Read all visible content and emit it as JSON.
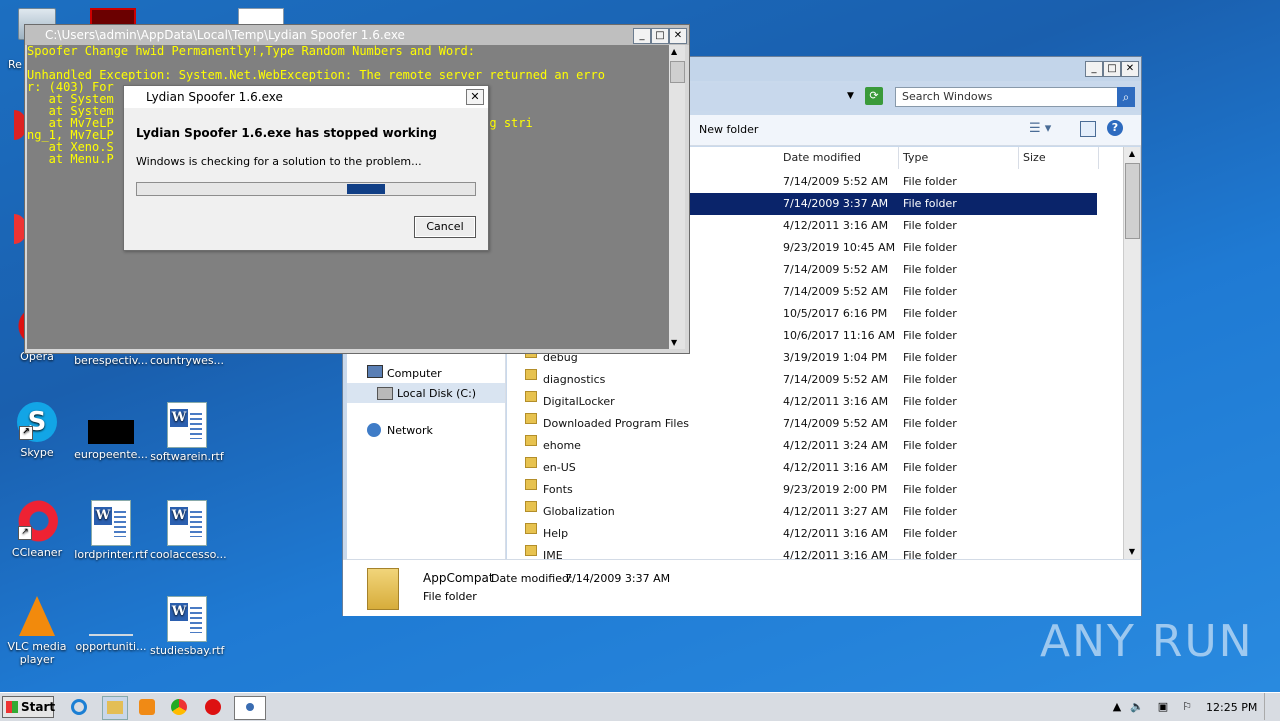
{
  "desktop": {
    "icons": [
      {
        "label": "Opera"
      },
      {
        "label": "berespectiv..."
      },
      {
        "label": "countrywes..."
      },
      {
        "label": "Skype"
      },
      {
        "label": "europeente..."
      },
      {
        "label": "softwarein.rtf"
      },
      {
        "label": "CCleaner"
      },
      {
        "label": "lordprinter.rtf"
      },
      {
        "label": "coolaccesso..."
      },
      {
        "label": "VLC media player"
      },
      {
        "label": "opportuniti..."
      },
      {
        "label": "studiesbay.rtf"
      }
    ],
    "partial_label_re": "Re",
    "watermark": "ANY RUN"
  },
  "console": {
    "title": "C:\\Users\\admin\\AppData\\Local\\Temp\\Lydian Spoofer 1.6.exe",
    "lines": [
      "Spoofer Change hwid Permanently!,Type Random Numbers and Word:",
      "",
      "Unhandled Exception: System.Net.WebException: The remote server returned an erro",
      "r: (403) For",
      "   at System                                    g fileName)",
      "   at System                                   ring fileName)",
      "   at Mv7eLP                                   y string_0, String stri",
      "ng_1, Mv7eLP",
      "   at Xeno.S",
      "   at Menu.P"
    ]
  },
  "dialog": {
    "title": "Lydian Spoofer 1.6.exe",
    "heading": "Lydian Spoofer 1.6.exe has stopped working",
    "message": "Windows is checking for a solution to the problem...",
    "cancel": "Cancel",
    "progress_marquee": true
  },
  "explorer": {
    "search_placeholder": "Search Windows",
    "new_folder": "New folder",
    "columns": {
      "date": "Date modified",
      "type": "Type",
      "size": "Size"
    },
    "nav": {
      "computer": "Computer",
      "local_disk": "Local Disk (C:)",
      "network": "Network"
    },
    "rows": [
      {
        "name": "",
        "date": "7/14/2009 5:52 AM",
        "type": "File folder",
        "selected": false
      },
      {
        "name": "",
        "date": "7/14/2009 3:37 AM",
        "type": "File folder",
        "selected": true
      },
      {
        "name": "",
        "date": "4/12/2011 3:16 AM",
        "type": "File folder",
        "selected": false
      },
      {
        "name": "",
        "date": "9/23/2019 10:45 AM",
        "type": "File folder",
        "selected": false
      },
      {
        "name": "",
        "date": "7/14/2009 5:52 AM",
        "type": "File folder",
        "selected": false
      },
      {
        "name": "",
        "date": "7/14/2009 5:52 AM",
        "type": "File folder",
        "selected": false
      },
      {
        "name": "",
        "date": "10/5/2017 6:16 PM",
        "type": "File folder",
        "selected": false
      },
      {
        "name": "",
        "date": "10/6/2017 11:16 AM",
        "type": "File folder",
        "selected": false
      },
      {
        "name": "debug",
        "date": "3/19/2019 1:04 PM",
        "type": "File folder",
        "selected": false
      },
      {
        "name": "diagnostics",
        "date": "7/14/2009 5:52 AM",
        "type": "File folder",
        "selected": false
      },
      {
        "name": "DigitalLocker",
        "date": "4/12/2011 3:16 AM",
        "type": "File folder",
        "selected": false
      },
      {
        "name": "Downloaded Program Files",
        "date": "7/14/2009 5:52 AM",
        "type": "File folder",
        "selected": false
      },
      {
        "name": "ehome",
        "date": "4/12/2011 3:24 AM",
        "type": "File folder",
        "selected": false
      },
      {
        "name": "en-US",
        "date": "4/12/2011 3:16 AM",
        "type": "File folder",
        "selected": false
      },
      {
        "name": "Fonts",
        "date": "9/23/2019 2:00 PM",
        "type": "File folder",
        "selected": false
      },
      {
        "name": "Globalization",
        "date": "4/12/2011 3:27 AM",
        "type": "File folder",
        "selected": false
      },
      {
        "name": "Help",
        "date": "4/12/2011 3:16 AM",
        "type": "File folder",
        "selected": false
      },
      {
        "name": "IME",
        "date": "4/12/2011 3:16 AM",
        "type": "File folder",
        "selected": false
      }
    ],
    "details": {
      "name": "AppCompat",
      "date_label": "Date modified:",
      "date_value": "7/14/2009 3:37 AM",
      "type": "File folder"
    }
  },
  "taskbar": {
    "start": "Start",
    "clock": "12:25 PM"
  }
}
